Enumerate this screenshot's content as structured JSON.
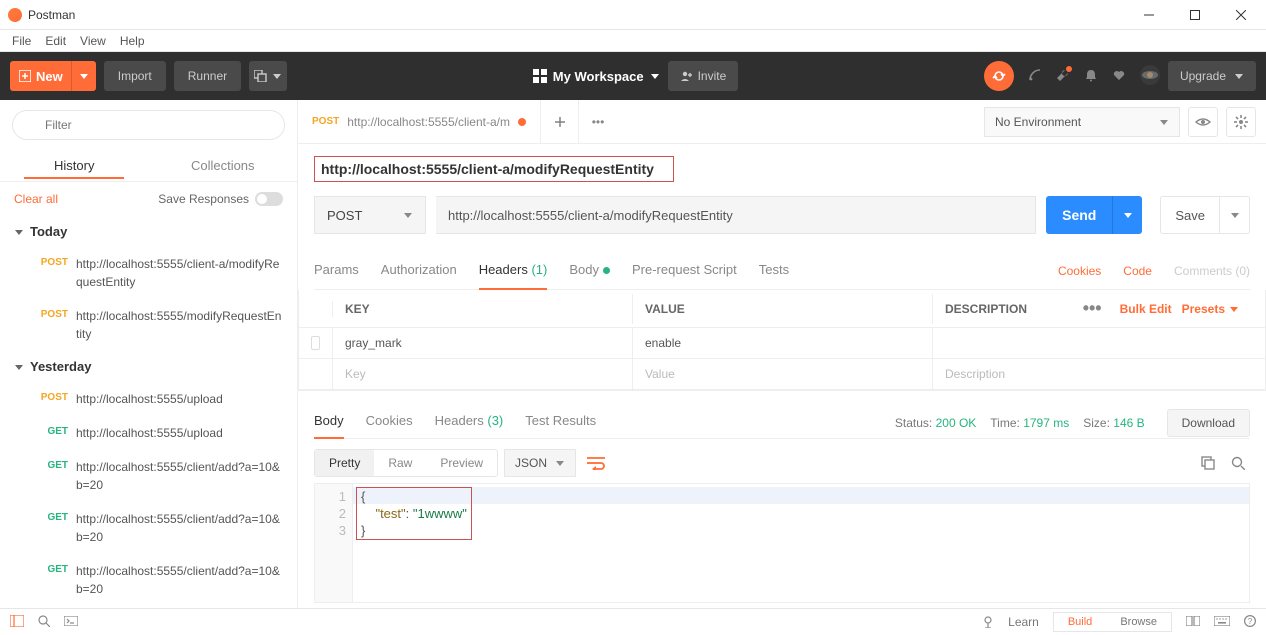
{
  "window": {
    "title": "Postman"
  },
  "menus": {
    "file": "File",
    "edit": "Edit",
    "view": "View",
    "help": "Help"
  },
  "toolbar": {
    "new": "New",
    "import": "Import",
    "runner": "Runner",
    "workspace": "My Workspace",
    "invite": "Invite",
    "upgrade": "Upgrade"
  },
  "sidebar": {
    "filter_placeholder": "Filter",
    "tab_history": "History",
    "tab_collections": "Collections",
    "clear": "Clear all",
    "save_responses": "Save Responses",
    "groups": [
      {
        "label": "Today",
        "items": [
          {
            "method": "POST",
            "url": "http://localhost:5555/client-a/modifyRequestEntity"
          },
          {
            "method": "POST",
            "url": "http://localhost:5555/modifyRequestEntity"
          }
        ]
      },
      {
        "label": "Yesterday",
        "items": [
          {
            "method": "POST",
            "url": "http://localhost:5555/upload"
          },
          {
            "method": "GET",
            "url": "http://localhost:5555/upload"
          },
          {
            "method": "GET",
            "url": "http://localhost:5555/client/add?a=10&b=20"
          },
          {
            "method": "GET",
            "url": "http://localhost:5555/client/add?a=10&b=20"
          },
          {
            "method": "GET",
            "url": "http://localhost:5555/client/add?a=10&b=20"
          }
        ]
      }
    ]
  },
  "tabstrip": {
    "tabs": [
      {
        "method": "POST",
        "url": "http://localhost:5555/client-a/m",
        "dirty": true
      }
    ]
  },
  "env": {
    "selected": "No Environment"
  },
  "request": {
    "name": "http://localhost:5555/client-a/modifyRequestEntity",
    "method": "POST",
    "url": "http://localhost:5555/client-a/modifyRequestEntity",
    "send": "Send",
    "save": "Save",
    "tabs": {
      "params": "Params",
      "authorization": "Authorization",
      "headers": "Headers",
      "headers_count": "(1)",
      "body": "Body",
      "prerequest": "Pre-request Script",
      "tests": "Tests"
    },
    "links": {
      "cookies": "Cookies",
      "code": "Code",
      "comments": "Comments (0)"
    }
  },
  "headers_table": {
    "head_key": "KEY",
    "head_val": "VALUE",
    "head_desc": "DESCRIPTION",
    "bulk": "Bulk Edit",
    "presets": "Presets",
    "rows": [
      {
        "key": "gray_mark",
        "value": "enable",
        "desc": ""
      }
    ],
    "ph_key": "Key",
    "ph_val": "Value",
    "ph_desc": "Description"
  },
  "response": {
    "tabs": {
      "body": "Body",
      "cookies": "Cookies",
      "headers": "Headers",
      "headers_count": "(3)",
      "tests": "Test Results"
    },
    "status_label": "Status:",
    "status_value": "200 OK",
    "time_label": "Time:",
    "time_value": "1797 ms",
    "size_label": "Size:",
    "size_value": "146 B",
    "download": "Download",
    "view": {
      "pretty": "Pretty",
      "raw": "Raw",
      "preview": "Preview",
      "fmt": "JSON"
    },
    "body_lines": {
      "l1": "{",
      "l2_key": "\"test\"",
      "l2_sep": ": ",
      "l2_val": "\"1wwww\"",
      "l3": "}"
    }
  },
  "statusbar": {
    "learn": "Learn",
    "build": "Build",
    "browse": "Browse"
  }
}
